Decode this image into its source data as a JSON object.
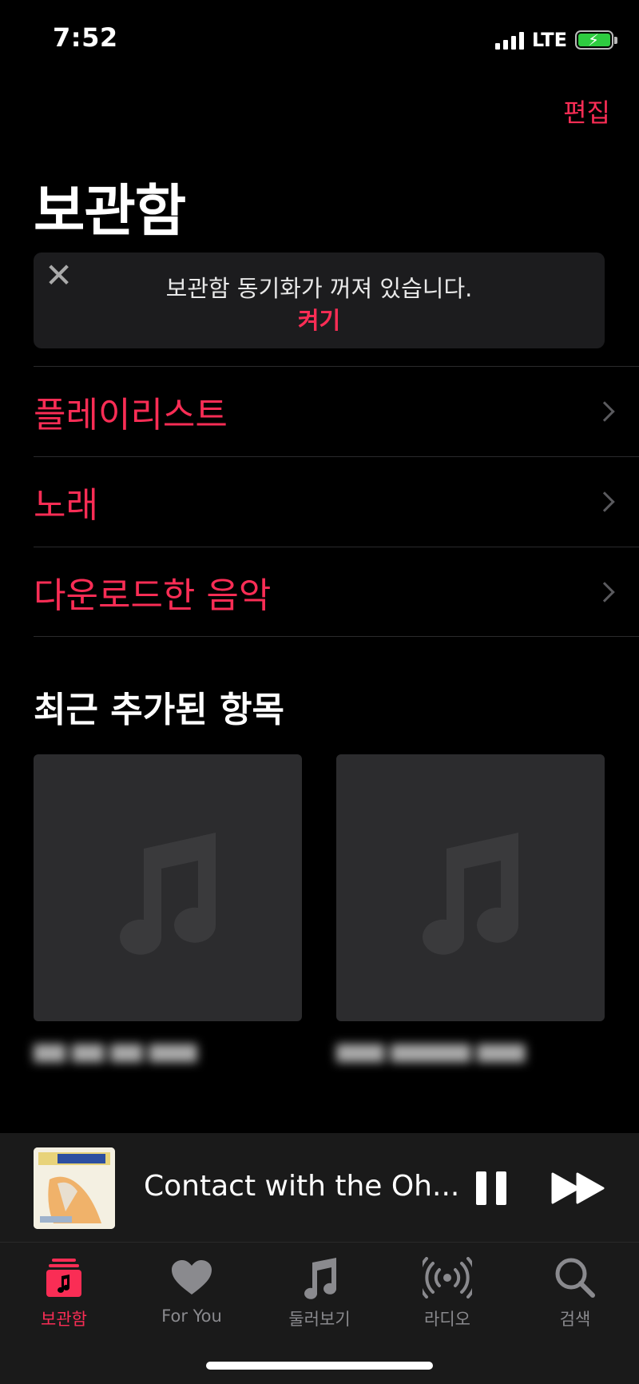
{
  "status_bar": {
    "time": "7:52",
    "network": "LTE"
  },
  "header": {
    "edit_label": "편집",
    "title": "보관함"
  },
  "sync_banner": {
    "close_icon": "close-icon",
    "message": "보관함 동기화가 꺼져 있습니다.",
    "action_label": "켜기"
  },
  "library": {
    "items": [
      {
        "label": "플레이리스트"
      },
      {
        "label": "노래"
      },
      {
        "label": "다운로드한 음악"
      }
    ]
  },
  "recently_added": {
    "title": "최근 추가된 항목",
    "albums": [
      {
        "art_icon": "music-note-icon"
      },
      {
        "art_icon": "music-note-icon"
      }
    ]
  },
  "mini_player": {
    "track_title": "Contact with the Oh...",
    "icons": [
      "pause-icon",
      "next-icon"
    ]
  },
  "tab_bar": {
    "tabs": [
      {
        "label": "보관함",
        "icon": "library-icon",
        "active": true
      },
      {
        "label": "For You",
        "icon": "heart-icon",
        "active": false
      },
      {
        "label": "둘러보기",
        "icon": "music-note-icon",
        "active": false
      },
      {
        "label": "라디오",
        "icon": "radio-icon",
        "active": false
      },
      {
        "label": "검색",
        "icon": "search-icon",
        "active": false
      }
    ]
  },
  "colors": {
    "accent": "#fa2d55",
    "background": "#000000",
    "card": "#1c1c1e",
    "inactive": "#8a8a8e"
  }
}
